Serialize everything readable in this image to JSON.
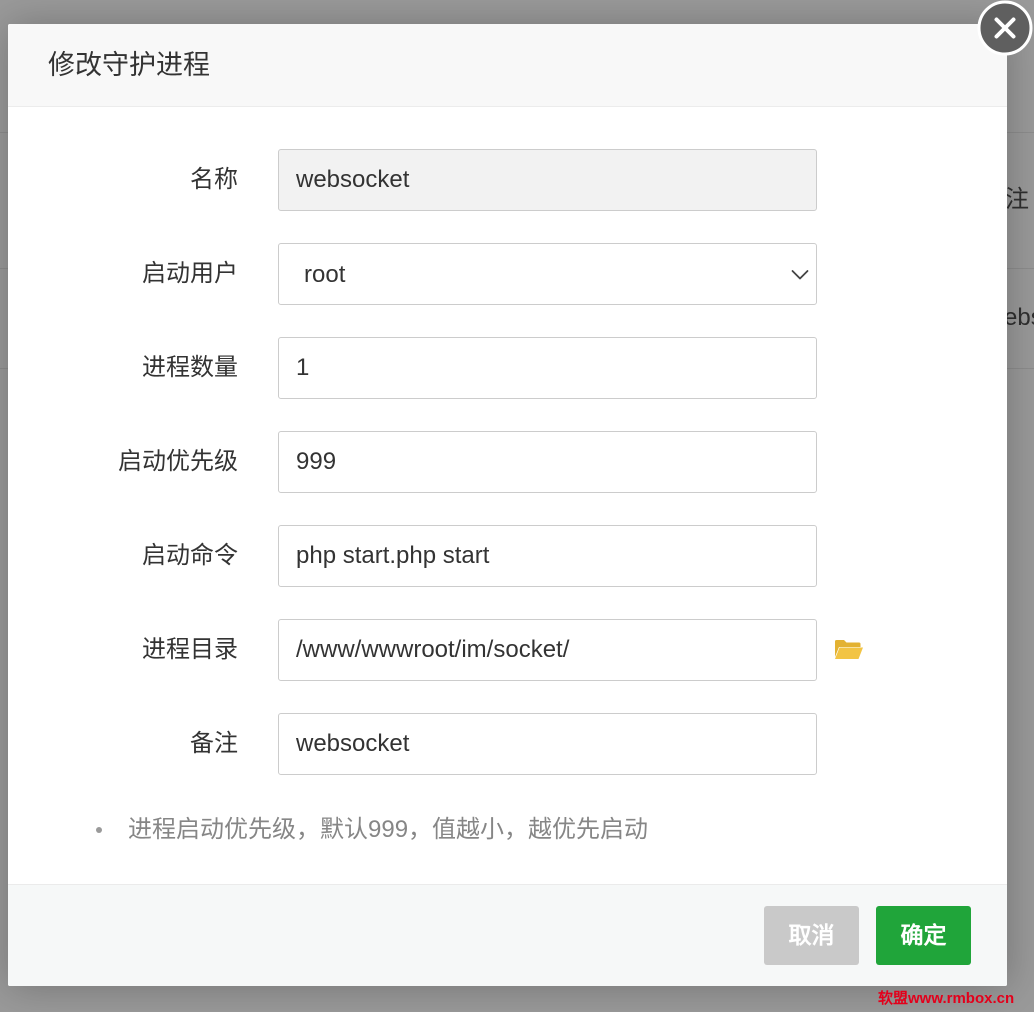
{
  "modal": {
    "title": "修改守护进程",
    "fields": {
      "name": {
        "label": "名称",
        "value": "websocket"
      },
      "run_user": {
        "label": "启动用户",
        "value": "root"
      },
      "process_count": {
        "label": "进程数量",
        "value": "1"
      },
      "priority": {
        "label": "启动优先级",
        "value": "999"
      },
      "command": {
        "label": "启动命令",
        "value": "php start.php start"
      },
      "directory": {
        "label": "进程目录",
        "value": "/www/wwwroot/im/socket/"
      },
      "remark": {
        "label": "备注",
        "value": "websocket"
      }
    },
    "note": "进程启动优先级，默认999，值越小，越优先启动",
    "buttons": {
      "cancel": "取消",
      "confirm": "确定"
    }
  },
  "background_fragments": {
    "row1": "注",
    "row2": "ebs"
  },
  "watermark": "软盟www.rmbox.cn",
  "icons": {
    "close": "close-icon",
    "select_arrow": "chevron-down-icon",
    "directory_picker": "folder-open-icon"
  },
  "colors": {
    "overlay": "#9a9a9a",
    "confirm_button": "#20a53a",
    "cancel_button": "#c9c9c9",
    "folder_icon": "#f2c444",
    "watermark": "#e3001b"
  }
}
